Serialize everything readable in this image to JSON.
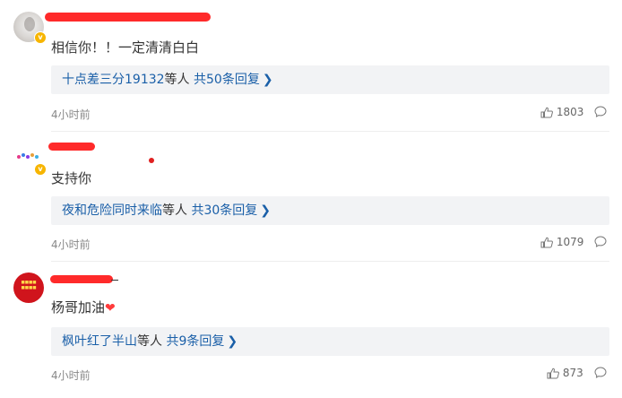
{
  "comments": [
    {
      "text": "相信你！！一定清清白白",
      "reply_summary": {
        "names": "十点差三分19132",
        "middle": "等人",
        "count": "共50条回复"
      },
      "time": "4小时前",
      "likes": "1803"
    },
    {
      "text": "支持你",
      "reply_summary": {
        "names": "夜和危险同时来临",
        "middle": "等人",
        "count": "共30条回复"
      },
      "time": "4小时前",
      "likes": "1079"
    },
    {
      "text": "杨哥加油",
      "reply_summary": {
        "names": "枫叶红了半山",
        "middle": "等人",
        "count": "共9条回复"
      },
      "time": "4小时前",
      "likes": "873"
    }
  ],
  "icons": {
    "verified": "verified-badge-icon",
    "like": "thumbs-up-icon",
    "reply": "speech-bubble-icon",
    "chevron": "chevron-right-icon",
    "heart": "red-heart-emoji"
  },
  "colors": {
    "link": "#1a5fa8",
    "redaction": "#ff2a2a",
    "reply_bg": "#f2f3f5",
    "verified": "#f7b500"
  }
}
